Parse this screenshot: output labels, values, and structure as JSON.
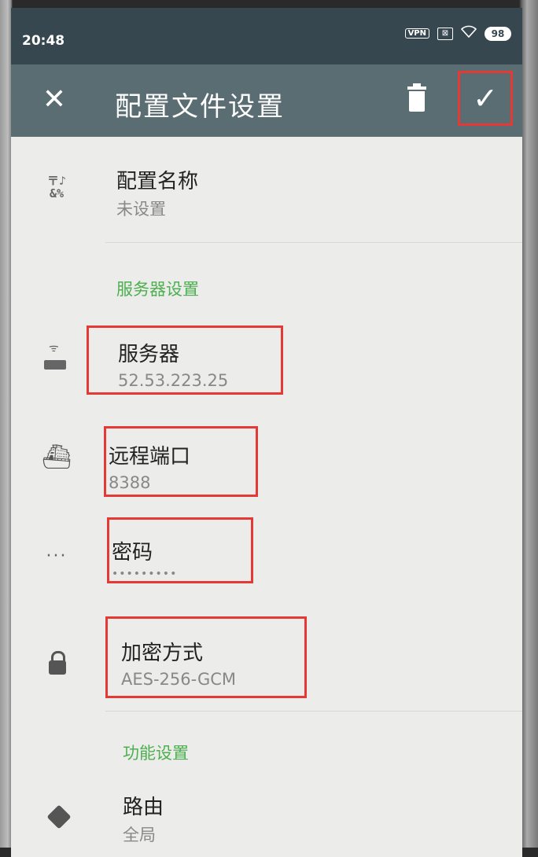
{
  "status_bar": {
    "time": "20:48",
    "vpn": "VPN",
    "sim": "⊠",
    "battery": "98"
  },
  "toolbar": {
    "close_icon": "close-icon",
    "close_glyph": "✕",
    "title": "配置文件设置",
    "delete_icon": "trash-icon",
    "confirm_icon": "check-icon",
    "confirm_glyph": "✓"
  },
  "profile": {
    "name_label": "配置名称",
    "name_value": "未设置"
  },
  "server_section": {
    "header": "服务器设置",
    "server_label": "服务器",
    "server_value": "52.53.223.25",
    "port_label": "远程端口",
    "port_value": "8388",
    "password_label": "密码",
    "password_value": "•••••••••",
    "encryption_label": "加密方式",
    "encryption_value": "AES-256-GCM"
  },
  "feature_section": {
    "header": "功能设置",
    "route_label": "路由",
    "route_value": "全局"
  },
  "colors": {
    "status_bar": "#37474f",
    "toolbar": "#5a6d72",
    "accent_green": "#4caf50",
    "highlight_red": "#e53935",
    "background": "#ececea"
  }
}
